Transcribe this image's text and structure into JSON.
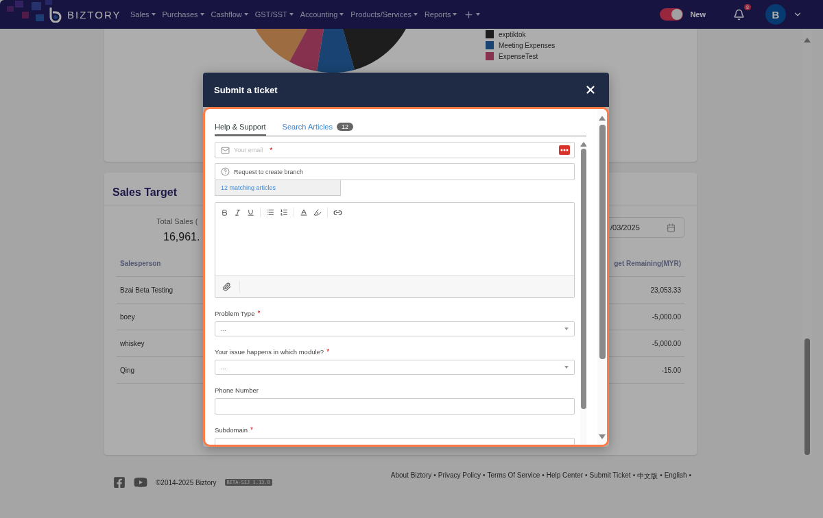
{
  "navbar": {
    "brand": "BIZTORY",
    "menu": [
      {
        "label": "Sales"
      },
      {
        "label": "Purchases"
      },
      {
        "label": "Cashflow"
      },
      {
        "label": "GST/SST"
      },
      {
        "label": "Accounting"
      },
      {
        "label": "Products/Services"
      },
      {
        "label": "Reports"
      }
    ],
    "toggle": {
      "label": "New",
      "on": true
    },
    "notification_count": "8",
    "avatar": "B"
  },
  "expense_chart": {
    "legend": [
      {
        "label": "exptiktok",
        "color": "#1d1d1d"
      },
      {
        "label": "Meeting Expenses",
        "color": "#194372"
      },
      {
        "label": "ExpenseTest",
        "color": "#87334f"
      }
    ]
  },
  "sales_target": {
    "title": "Sales Target",
    "total_label": "Total Sales (",
    "total_value": "16,961.",
    "date": "/03/2025",
    "columns": [
      "Salesperson",
      "get Remaining(MYR)"
    ],
    "rows": [
      {
        "salesperson": "Bzai Beta Testing",
        "remaining": "23,053.33"
      },
      {
        "salesperson": "boey",
        "remaining": "-5,000.00"
      },
      {
        "salesperson": "whiskey",
        "remaining": "-5,000.00"
      },
      {
        "salesperson": "Qing",
        "remaining": "-15.00"
      }
    ]
  },
  "footer": {
    "copyright": "©2014-2025 Biztory",
    "version": "BETA-SIJ 1.13.0",
    "separator": "•",
    "links": [
      "About Biztory",
      "Privacy Policy",
      "Terms Of Service",
      "Help Center",
      "Submit Ticket",
      "中文版",
      "English"
    ]
  },
  "modal": {
    "title": "Submit a ticket",
    "tabs": [
      {
        "label": "Help & Support",
        "selected": true
      },
      {
        "label": "Search Articles",
        "count": "12",
        "selected": false
      }
    ],
    "email": {
      "placeholder": "Your email",
      "required_mark": "*"
    },
    "subject": {
      "value": "Request to create branch"
    },
    "suggestion": "12 matching articles",
    "fields": [
      {
        "label": "Problem Type",
        "required_mark": "*",
        "kind": "select",
        "value": "..."
      },
      {
        "label": "Your issue happens in which module?",
        "required_mark": "*",
        "kind": "select",
        "value": "..."
      },
      {
        "label": "Phone Number",
        "kind": "input"
      },
      {
        "label": "Subdomain",
        "required_mark": "*",
        "kind": "input"
      }
    ]
  }
}
